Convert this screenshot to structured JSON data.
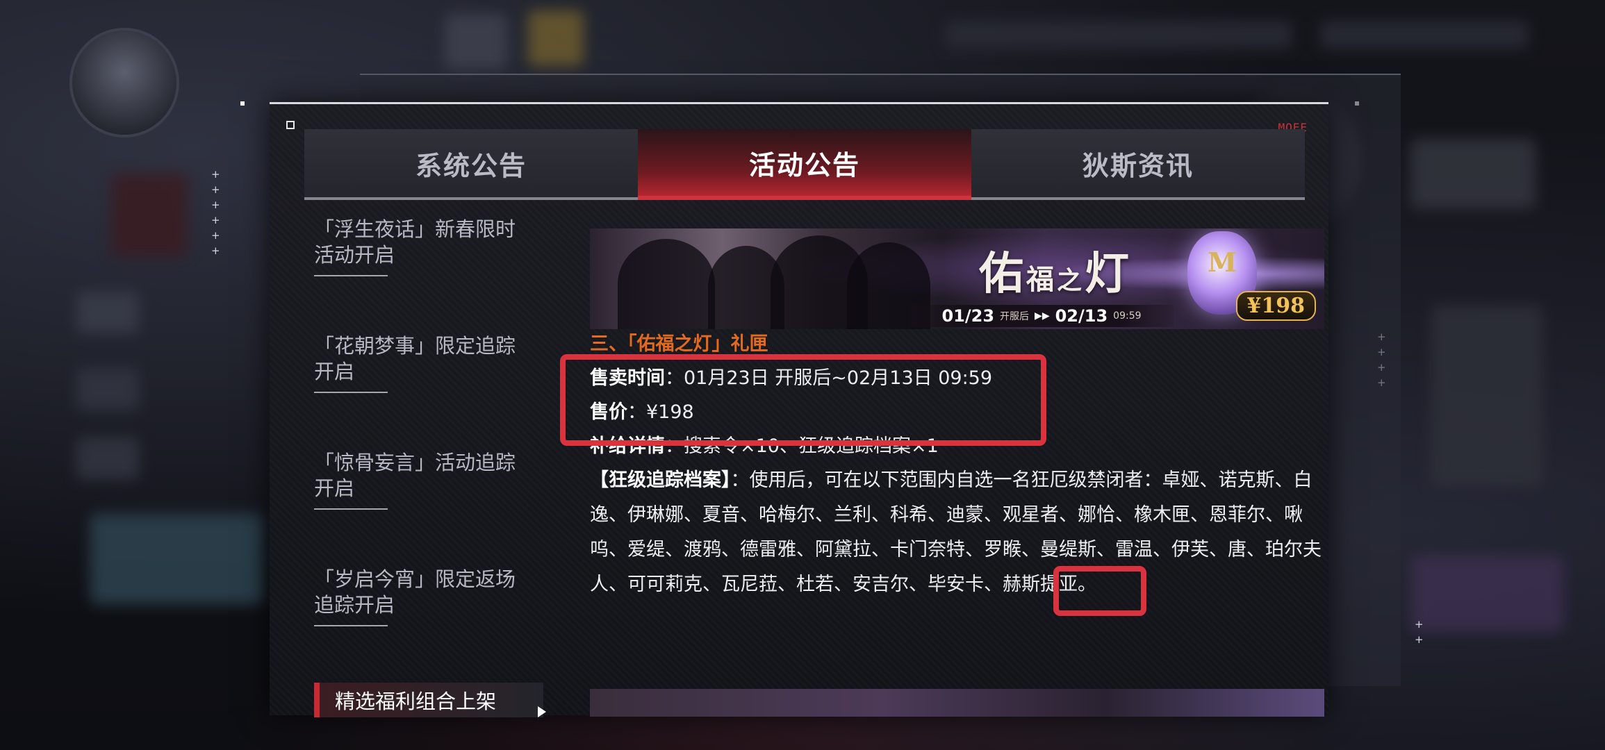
{
  "tabs": [
    {
      "label": "系统公告",
      "active": false
    },
    {
      "label": "活动公告",
      "active": true
    },
    {
      "label": "狄斯资讯",
      "active": false
    }
  ],
  "side_list": [
    {
      "label": "「浮生夜话」新春限时活动开启"
    },
    {
      "label": "「花朝梦事」限定追踪开启"
    },
    {
      "label": "「惊骨妄言」活动追踪开启"
    },
    {
      "label": "「岁启今宵」限定返场追踪开启"
    }
  ],
  "side_active": {
    "label": "精选福利组合上架"
  },
  "banner": {
    "title_main": "佑",
    "title_small": "福",
    "title_mid": "之",
    "title_end": "灯",
    "lantern_letter": "M",
    "date_start": "01/23",
    "date_start_note": "开服后",
    "date_arrows": "▶▶",
    "date_end": "02/13",
    "date_end_time": "09:59",
    "price": "¥198"
  },
  "article": {
    "heading": "三、「佑福之灯」礼匣",
    "sale_time_key": "售卖时间",
    "sale_time_val": "：01月23日 开服后~02月13日 09:59",
    "price_key": "售价",
    "price_val": "：¥198",
    "supply_key": "补给详情",
    "supply_val": "：搜索令×10、狂级追踪档案×1",
    "file_key": "【狂级追踪档案】",
    "file_val": "：使用后，可在以下范围内自选一名狂厄级禁闭者：卓娅、诺克斯、白逸、伊琳娜、夏音、哈梅尔、兰利、科希、迪蒙、观星者、娜恰、橡木匣、恩菲尔、啾呜、爱缇、渡鸦、德雷雅、阿黛拉、卡门奈特、罗睺、曼缇斯、雷温、伊芙、唐、珀尔夫人、可可莉克、瓦尼菈、杜若、安吉尔、毕安卡、赫斯提亚。"
  },
  "panel_tag": "MOEE",
  "colors": {
    "accent_red": "#c52a35",
    "highlight_box": "#d93340",
    "heading_orange": "#e36a1f",
    "price_gold": "#f3c25b"
  }
}
